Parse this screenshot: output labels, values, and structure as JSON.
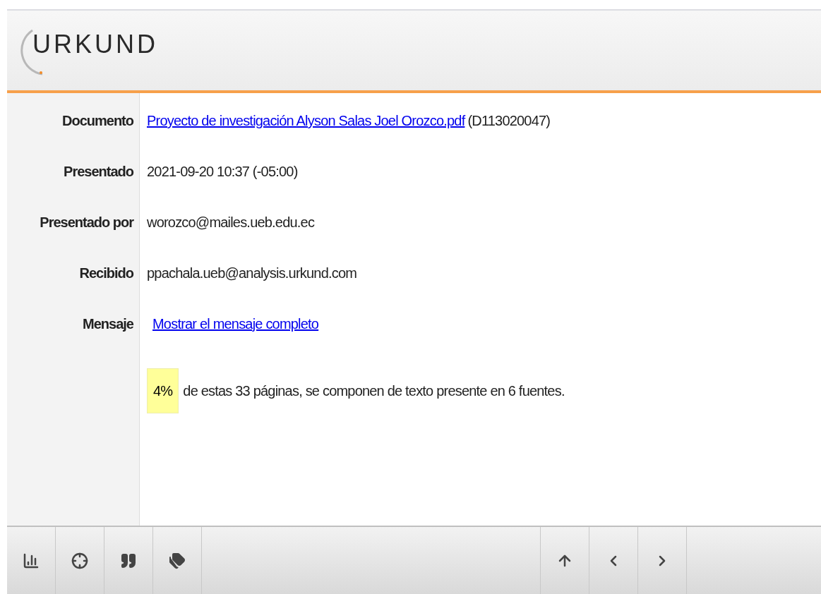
{
  "logo": {
    "text": "URKUND"
  },
  "fields": [
    {
      "label": "Documento",
      "link": "Proyecto de investigación Alyson Salas Joel Orozco.pdf",
      "value": "(D113020047)"
    },
    {
      "label": "Presentado",
      "value": "2021-09-20 10:37 (-05:00)"
    },
    {
      "label": "Presentado por",
      "value": "worozco@mailes.ueb.edu.ec"
    },
    {
      "label": "Recibido",
      "value": "ppachala.ueb@analysis.urkund.com"
    },
    {
      "label": "Mensaje",
      "link": "Mostrar el mensaje completo"
    }
  ],
  "summary": {
    "percent": "4%",
    "text": "de estas 33 páginas, se componen de texto presente en 6 fuentes."
  }
}
